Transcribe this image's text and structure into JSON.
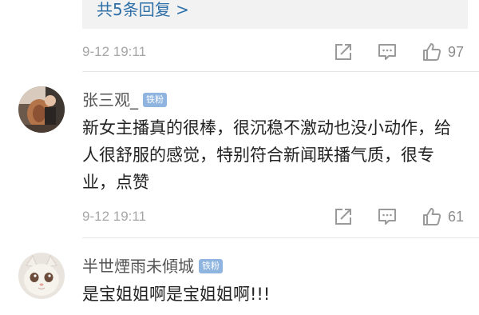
{
  "top_reply": {
    "label": "共5条回复 >"
  },
  "meta_top": {
    "time": "9-12 19:11",
    "like_count": "97"
  },
  "comments": [
    {
      "username": "张三观_",
      "badge": "铁粉",
      "text": "新女主播真的很棒，很沉稳不激动也没小动作，给人很舒服的感觉，特别符合新闻联播气质，很专业，点赞",
      "time": "9-12 19:11",
      "like_count": "61"
    },
    {
      "username": "半世煙雨未傾城",
      "badge": "铁粉",
      "text": "是宝姐姐啊是宝姐姐啊!!!"
    }
  ],
  "icons": {
    "share": "share-icon",
    "comment": "comment-icon",
    "like": "thumbs-up-icon"
  },
  "colors": {
    "link": "#2e6fa8",
    "badge": "#8eb4df",
    "meta": "#a6a6a6",
    "text": "#222222"
  }
}
